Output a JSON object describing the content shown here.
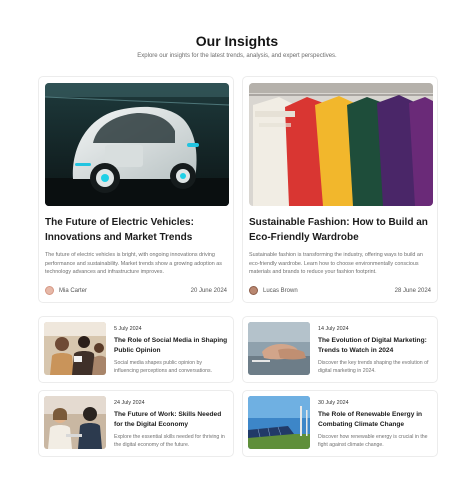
{
  "header": {
    "title": "Our Insights",
    "subtitle": "Explore our insights for the latest trends, analysis, and expert perspectives."
  },
  "featured": [
    {
      "title": "The Future of Electric Vehicles: Innovations and Market Trends",
      "description": "The future of electric vehicles is bright, with ongoing innovations driving performance and sustainability. Market trends show a growing adoption as technology advances and infrastructure improves.",
      "author": "Mia Carter",
      "date": "20 June 2024",
      "image": "electric-vehicle-photo"
    },
    {
      "title": "Sustainable Fashion: How to Build an Eco-Friendly Wardrobe",
      "description": "Sustainable fashion is transforming the industry, offering ways to build an eco-friendly wardrobe. Learn how to choose environmentally conscious materials and brands to reduce your fashion footprint.",
      "author": "Lucas Brown",
      "date": "28 June 2024",
      "image": "sweaters-on-rack-photo"
    }
  ],
  "posts": [
    {
      "date": "5 July 2024",
      "title": "The Role of Social Media in Shaping Public Opinion",
      "description": "Social media shapes public opinion by influencing perceptions and conversations.",
      "image": "people-with-phones-photo"
    },
    {
      "date": "14 July 2024",
      "title": "The Evolution of Digital Marketing: Trends to Watch in 2024",
      "description": "Discover the key trends shaping the evolution of digital marketing in 2024.",
      "image": "hands-on-table-photo"
    },
    {
      "date": "24 July 2024",
      "title": "The Future of Work: Skills Needed for the Digital Economy",
      "description": "Explore the essential skills needed for thriving in the digital economy of the future.",
      "image": "office-meeting-photo"
    },
    {
      "date": "30 July 2024",
      "title": "The Role of Renewable Energy in Combating Climate Change",
      "description": "Discover how renewable energy is crucial in the fight against climate change.",
      "image": "solar-panels-photo"
    }
  ]
}
